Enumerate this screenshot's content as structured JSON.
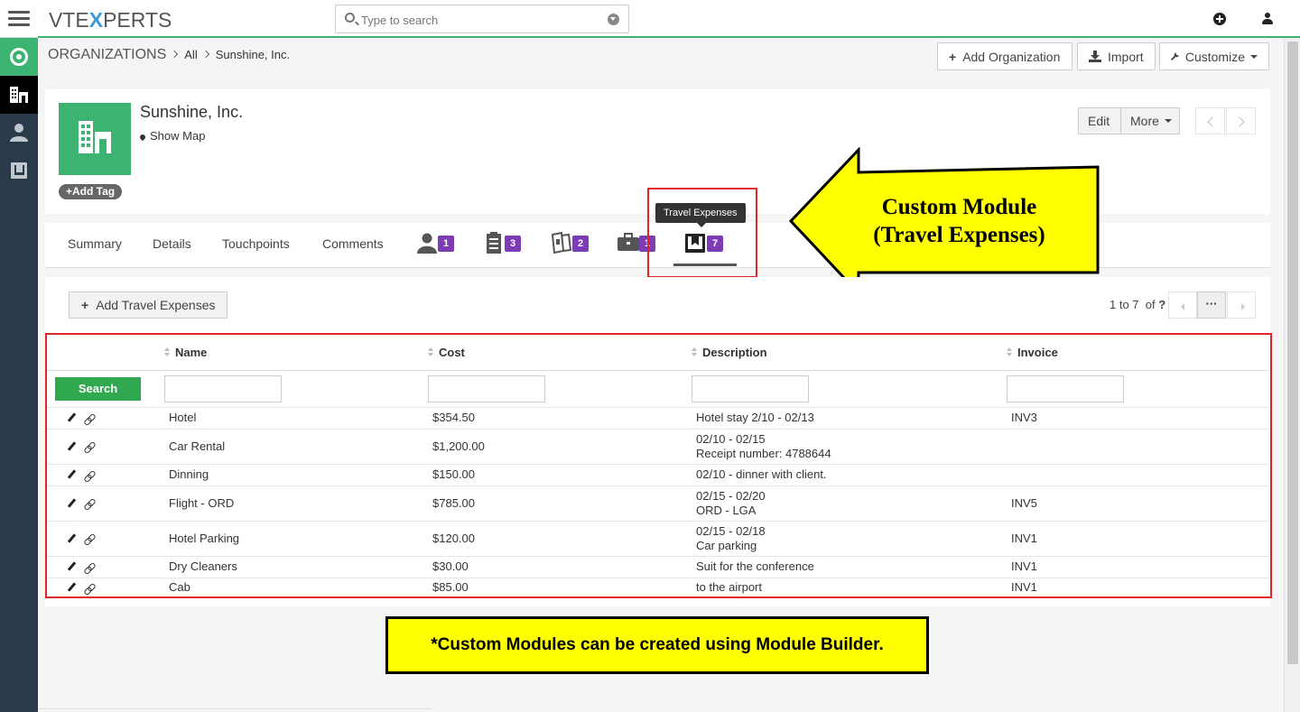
{
  "app": {
    "logo_part1": "VTE",
    "logo_part2": "X",
    "logo_part3": "PERTS"
  },
  "search": {
    "placeholder": "Type to search"
  },
  "breadcrumb": {
    "module": "ORGANIZATIONS",
    "filter": "All",
    "record": "Sunshine, Inc."
  },
  "header_buttons": {
    "add": "Add Organization",
    "import": "Import",
    "customize": "Customize"
  },
  "record": {
    "name": "Sunshine, Inc.",
    "show_map": "Show Map",
    "add_tag": "Add Tag",
    "edit": "Edit",
    "more": "More"
  },
  "tabs": {
    "summary": "Summary",
    "details": "Details",
    "touchpoints": "Touchpoints",
    "comments": "Comments",
    "related": [
      {
        "icon": "contacts-icon",
        "count": "1"
      },
      {
        "icon": "tickets-icon",
        "count": "3"
      },
      {
        "icon": "deals-icon",
        "count": "2"
      },
      {
        "icon": "briefcase-icon",
        "count": "1"
      },
      {
        "icon": "book-icon",
        "count": "7"
      }
    ],
    "tooltip": "Travel Expenses"
  },
  "annotation": {
    "line1": "Custom Module",
    "line2": "(Travel Expenses)",
    "note": "*Custom Modules can be created using Module Builder."
  },
  "related_list": {
    "add_button": "Add Travel Expenses",
    "pager": {
      "range": "1 to 7",
      "of": "of",
      "total": "?",
      "more": "···"
    },
    "search_button": "Search",
    "columns": [
      "Name",
      "Cost",
      "Description",
      "Invoice"
    ],
    "rows": [
      {
        "name": "Hotel",
        "cost": "$354.50",
        "desc1": "Hotel stay 2/10 - 02/13",
        "desc2": "",
        "invoice": "INV3"
      },
      {
        "name": "Car Rental",
        "cost": "$1,200.00",
        "desc1": "02/10 - 02/15",
        "desc2": "Receipt number: 4788644",
        "invoice": ""
      },
      {
        "name": "Dinning",
        "cost": "$150.00",
        "desc1": "02/10 - dinner with client.",
        "desc2": "",
        "invoice": ""
      },
      {
        "name": "Flight - ORD",
        "cost": "$785.00",
        "desc1": "02/15 - 02/20",
        "desc2": "ORD - LGA",
        "invoice": "INV5"
      },
      {
        "name": "Hotel Parking",
        "cost": "$120.00",
        "desc1": "02/15 - 02/18",
        "desc2": "Car parking",
        "invoice": "INV1"
      },
      {
        "name": "Dry Cleaners",
        "cost": "$30.00",
        "desc1": "Suit for the conference",
        "desc2": "",
        "invoice": "INV1"
      },
      {
        "name": "Cab",
        "cost": "$85.00",
        "desc1": "to the airport",
        "desc2": "",
        "invoice": "INV1"
      }
    ]
  },
  "colors": {
    "accent": "#3cb371",
    "rail": "#2b3a4a",
    "badge": "#7d3cb5",
    "highlight_box": "#e0252a",
    "callout": "#ffff00"
  }
}
